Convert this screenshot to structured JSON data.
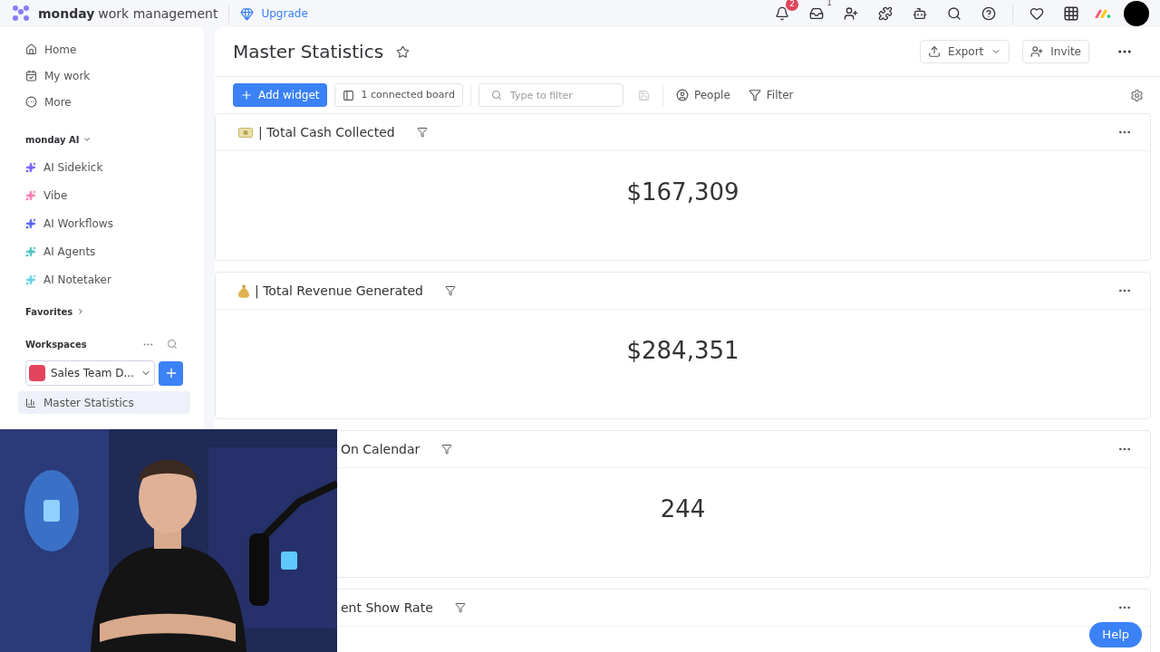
{
  "topbar": {
    "brand_bold": "monday",
    "brand_rest": "work management",
    "upgrade": "Upgrade",
    "notifications_badge": "2",
    "inbox_badge": "1"
  },
  "sidebar": {
    "nav": [
      {
        "label": "Home",
        "kind": "home"
      },
      {
        "label": "My work",
        "kind": "calendar"
      },
      {
        "label": "More",
        "kind": "more"
      }
    ],
    "ai_heading": "monday AI",
    "ai_items": [
      {
        "label": "AI Sidekick",
        "color": "#7b61ff"
      },
      {
        "label": "Vibe",
        "color": "#ff7eb3"
      },
      {
        "label": "AI Workflows",
        "color": "#5a67f2"
      },
      {
        "label": "AI Agents",
        "color": "#4fc3c7"
      },
      {
        "label": "AI Notetaker",
        "color": "#6ad3e8"
      }
    ],
    "favorites": "Favorites",
    "workspaces": "Workspaces",
    "workspace_name": "Sales Team D...",
    "boards": [
      {
        "label": "Master Statistics",
        "selected": true
      }
    ]
  },
  "page": {
    "title": "Master Statistics",
    "export": "Export",
    "invite": "Invite",
    "toolbar": {
      "add_widget": "Add widget",
      "connected": "1 connected board",
      "filter_placeholder": "Type to filter",
      "people": "People",
      "filter": "Filter"
    },
    "widgets": [
      {
        "kind": "cash",
        "title": "| Total Cash Collected",
        "value": "$167,309"
      },
      {
        "kind": "bag",
        "title": "| Total Revenue Generated",
        "value": "$284,351"
      },
      {
        "kind": "covered",
        "title": "On Calendar",
        "value": "244"
      },
      {
        "kind": "covered",
        "title": "ent Show Rate"
      }
    ]
  },
  "help": "Help"
}
